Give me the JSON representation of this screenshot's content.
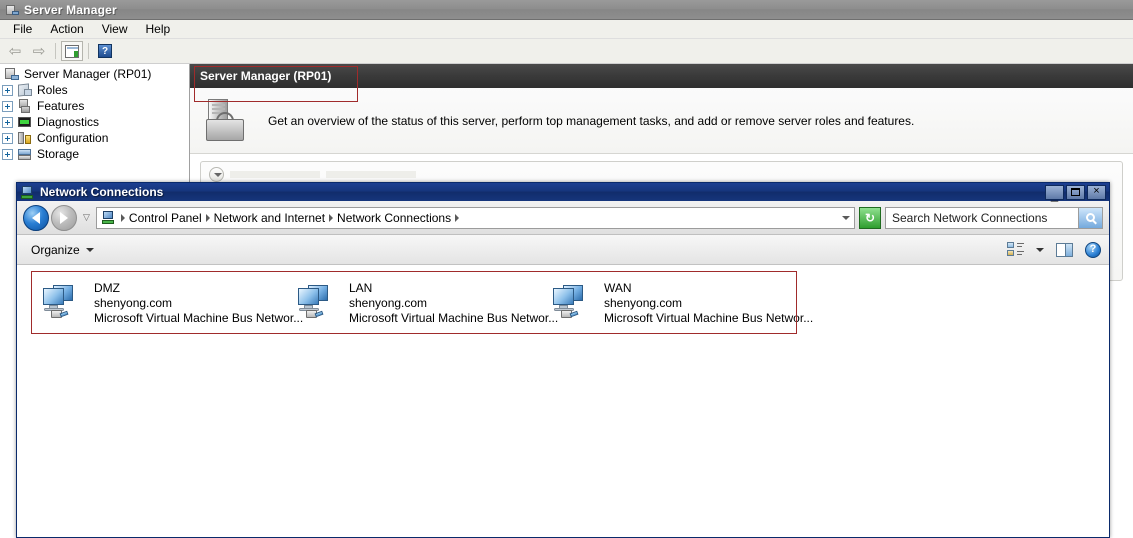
{
  "server_manager": {
    "window_title": "Server Manager",
    "title_icon": "server-manager-icon",
    "menu": [
      {
        "label": "File"
      },
      {
        "label": "Action"
      },
      {
        "label": "View"
      },
      {
        "label": "Help"
      }
    ],
    "toolbar": {
      "back_icon": "back-arrow-icon",
      "forward_icon": "forward-arrow-icon",
      "properties_icon": "properties-icon",
      "help_icon": "help-icon"
    },
    "tree": {
      "root": {
        "label": "Server Manager (RP01)",
        "icon": "server-manager-node-icon"
      },
      "items": [
        {
          "label": "Roles",
          "icon": "roles-icon",
          "expander": "+"
        },
        {
          "label": "Features",
          "icon": "features-icon",
          "expander": "+"
        },
        {
          "label": "Diagnostics",
          "icon": "diagnostics-icon",
          "expander": "+"
        },
        {
          "label": "Configuration",
          "icon": "configuration-icon",
          "expander": "+"
        },
        {
          "label": "Storage",
          "icon": "storage-icon",
          "expander": "+"
        }
      ]
    },
    "content": {
      "banner_title": "Server Manager (RP01)",
      "overview_icon": "server-tower-icon",
      "overview_text": "Get an overview of the status of this server, perform top management tasks, and add or remove server roles and features."
    },
    "annotation": {
      "highlight_color": "#a02b2b",
      "target": "banner_title"
    }
  },
  "network_connections": {
    "window_title": "Network Connections",
    "title_icon": "network-connections-icon",
    "window_buttons": {
      "minimize": "_",
      "maximize": "maximize-icon",
      "close": "×"
    },
    "navigation": {
      "back_icon": "back-navigation-icon",
      "forward_icon": "forward-navigation-icon",
      "history_icon": "recent-pages-icon"
    },
    "breadcrumb": {
      "leading_icon": "control-panel-icon",
      "items": [
        {
          "label": "Control Panel"
        },
        {
          "label": "Network and Internet"
        },
        {
          "label": "Network Connections"
        }
      ],
      "dropdown_icon": "address-dropdown-icon"
    },
    "refresh": {
      "icon": "refresh-icon",
      "glyph": "↻"
    },
    "search": {
      "placeholder": "Search Network Connections",
      "icon": "search-icon"
    },
    "toolbar": {
      "organize_label": "Organize",
      "organize_caret": "chevron-down-icon",
      "views_icon": "change-view-icon",
      "views_caret": "chevron-down-icon",
      "preview_pane_icon": "preview-pane-icon",
      "help_icon": "help-icon",
      "help_glyph": "?"
    },
    "connections": [
      {
        "name": "DMZ",
        "domain": "shenyong.com",
        "adapter": "Microsoft Virtual Machine Bus Networ...",
        "icon": "network-adapter-icon"
      },
      {
        "name": "LAN",
        "domain": "shenyong.com",
        "adapter": "Microsoft Virtual Machine Bus Networ...",
        "icon": "network-adapter-icon"
      },
      {
        "name": "WAN",
        "domain": "shenyong.com",
        "adapter": "Microsoft Virtual Machine Bus Networ...",
        "icon": "network-adapter-icon"
      }
    ],
    "annotation": {
      "highlight_color": "#a02b2b",
      "target": "connections-list"
    }
  }
}
